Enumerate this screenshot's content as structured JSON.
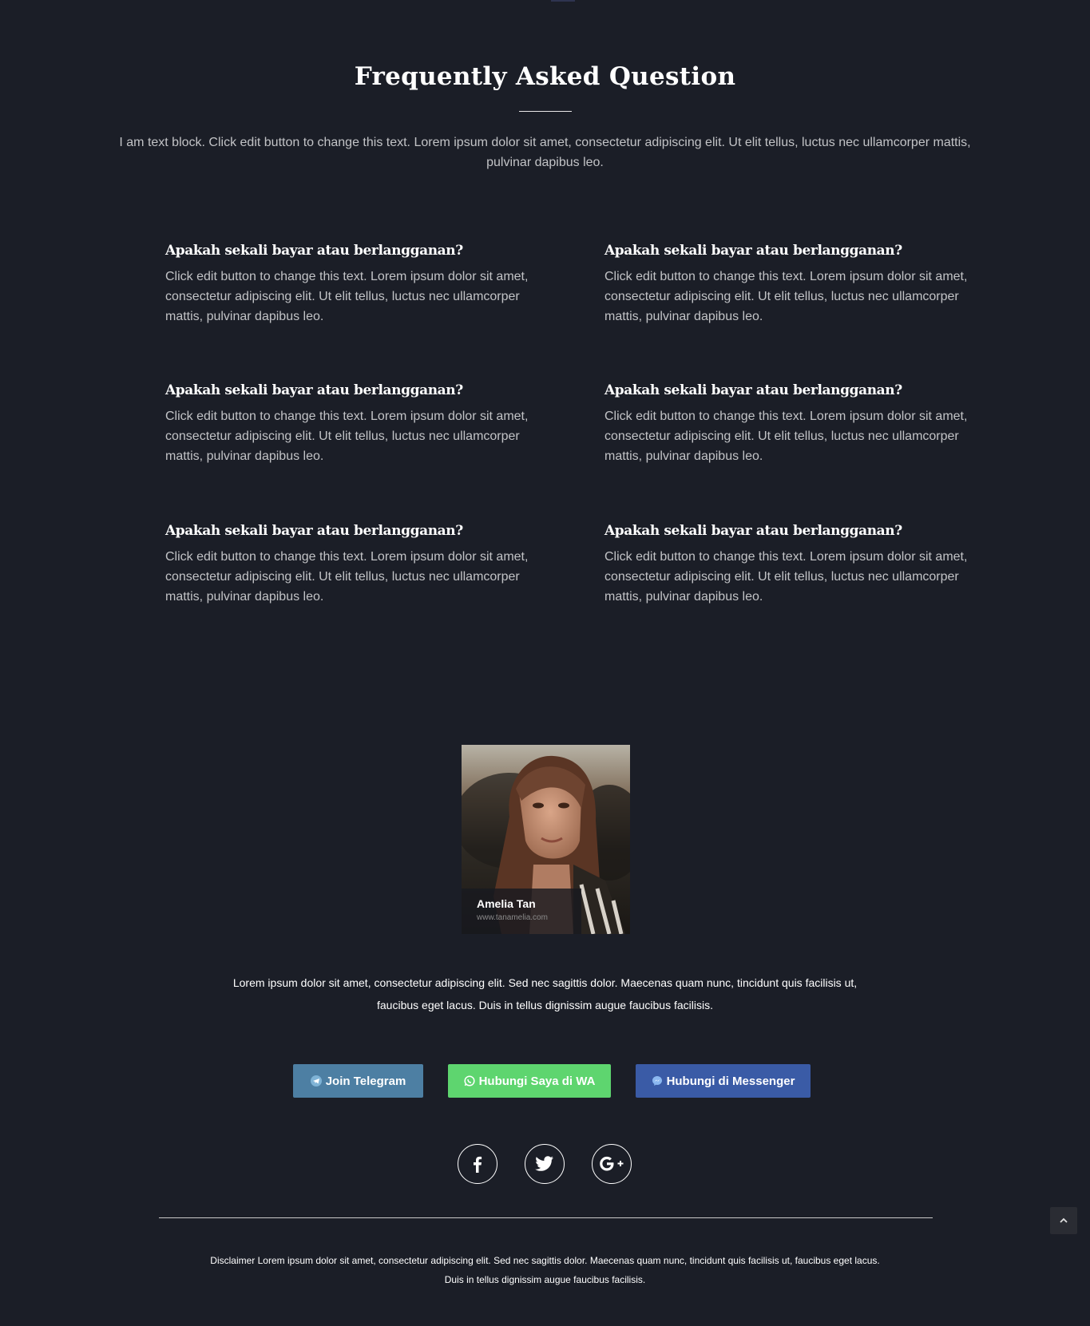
{
  "faq": {
    "title": "Frequently Asked Question",
    "intro": "I am text block. Click edit button to change this text. Lorem ipsum dolor sit amet, consectetur adipiscing elit. Ut elit tellus, luctus nec ullamcorper mattis, pulvinar dapibus leo.",
    "items": [
      {
        "question": "Apakah sekali bayar atau berlangganan?",
        "answer": "Click edit button to change this text. Lorem ipsum dolor sit amet, consectetur adipiscing elit. Ut elit tellus, luctus nec ullamcorper mattis, pulvinar dapibus leo."
      },
      {
        "question": "Apakah sekali bayar atau berlangganan?",
        "answer": "Click edit button to change this text. Lorem ipsum dolor sit amet, consectetur adipiscing elit. Ut elit tellus, luctus nec ullamcorper mattis, pulvinar dapibus leo."
      },
      {
        "question": "Apakah sekali bayar atau berlangganan?",
        "answer": "Click edit button to change this text. Lorem ipsum dolor sit amet, consectetur adipiscing elit. Ut elit tellus, luctus nec ullamcorper mattis, pulvinar dapibus leo."
      },
      {
        "question": "Apakah sekali bayar atau berlangganan?",
        "answer": "Click edit button to change this text. Lorem ipsum dolor sit amet, consectetur adipiscing elit. Ut elit tellus, luctus nec ullamcorper mattis, pulvinar dapibus leo."
      },
      {
        "question": "Apakah sekali bayar atau berlangganan?",
        "answer": "Click edit button to change this text. Lorem ipsum dolor sit amet, consectetur adipiscing elit. Ut elit tellus, luctus nec ullamcorper mattis, pulvinar dapibus leo."
      },
      {
        "question": "Apakah sekali bayar atau berlangganan?",
        "answer": "Click edit button to change this text. Lorem ipsum dolor sit amet, consectetur adipiscing elit. Ut elit tellus, luctus nec ullamcorper mattis, pulvinar dapibus leo."
      }
    ]
  },
  "profile": {
    "name": "Amelia Tan",
    "website": "www.tanamelia.com",
    "photo_icon": "portrait-photo"
  },
  "about": {
    "text": "Lorem ipsum dolor sit amet, consectetur adipiscing elit. Sed nec sagittis dolor. Maecenas quam nunc, tincidunt quis facilisis ut, faucibus eget lacus. Duis in tellus dignissim augue faucibus facilisis."
  },
  "buttons": {
    "telegram": {
      "label": "Join Telegram",
      "icon": "telegram-icon",
      "color": "#4d7fa3"
    },
    "whatsapp": {
      "label": "Hubungi Saya di WA",
      "icon": "whatsapp-icon",
      "color": "#5ed56f"
    },
    "messenger": {
      "label": "Hubungi di Messenger",
      "icon": "messenger-icon",
      "color": "#3a5ba6"
    }
  },
  "social": [
    {
      "name": "facebook",
      "icon": "facebook-icon"
    },
    {
      "name": "twitter",
      "icon": "twitter-icon"
    },
    {
      "name": "google-plus",
      "icon": "google-plus-icon"
    }
  ],
  "footer": {
    "disclaimer": "Disclaimer Lorem ipsum dolor sit amet, consectetur adipiscing elit. Sed nec sagittis dolor. Maecenas quam nunc, tincidunt quis facilisis ut, faucibus eget lacus. Duis in tellus dignissim augue faucibus facilisis."
  },
  "scroll_top": {
    "icon": "chevron-up-icon"
  },
  "colors": {
    "background": "#1b1e27",
    "heading": "#ffffff",
    "body_text": "#c2c3c6"
  }
}
